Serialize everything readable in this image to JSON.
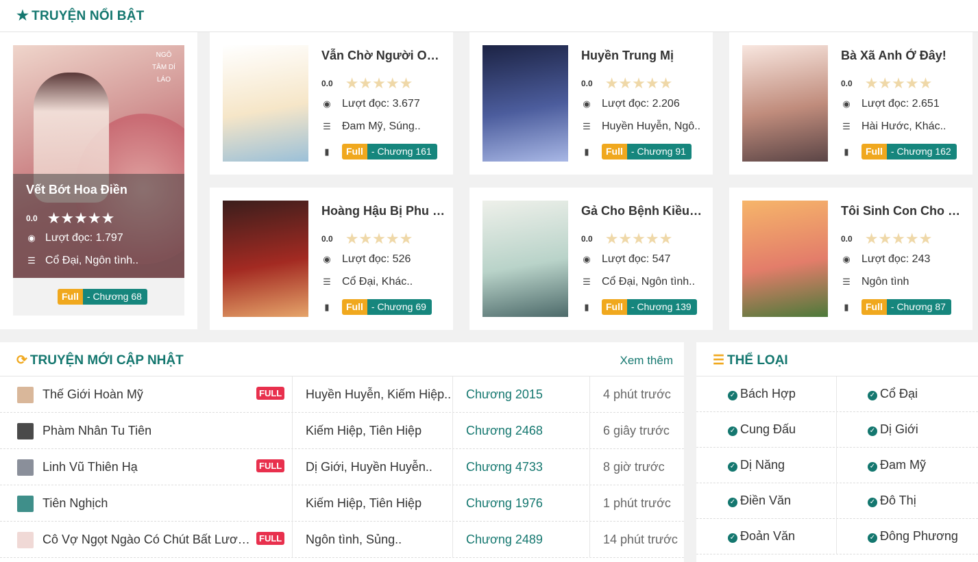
{
  "hot": {
    "title": "TRUYỆN NỔI BẬT",
    "featured": {
      "title": "Vết Bớt Hoa Điền",
      "rating": "0.0",
      "views": "Lượt đọc: 1.797",
      "genres": "Cổ Đại, Ngôn tình..",
      "full": "Full",
      "chapter": "- Chương 68",
      "cover_text": "Vết Bớt Hoa Điền",
      "cover_author": "NGÔ TÂM DÍ LÁO"
    },
    "cards": [
      {
        "title": "Vẫn Chờ Người Onlin...",
        "rating": "0.0",
        "views": "Lượt đọc: 3.677",
        "genres": "Đam Mỹ, Súng..",
        "full": "Full",
        "chapter": "- Chương 161",
        "colors": [
          "#ffffff",
          "#f6e6c8",
          "#9bc0d8"
        ]
      },
      {
        "title": "Huyền Trung Mị",
        "rating": "0.0",
        "views": "Lượt đọc: 2.206",
        "genres": "Huyền Huyễn, Ngô..",
        "full": "Full",
        "chapter": "- Chương 91",
        "colors": [
          "#1c2344",
          "#4c5d9d",
          "#a8b7e5"
        ]
      },
      {
        "title": "Bà Xã Anh Ở Đây!",
        "rating": "0.0",
        "views": "Lượt đọc: 2.651",
        "genres": "Hài Hước, Khác..",
        "full": "Full",
        "chapter": "- Chương 162",
        "colors": [
          "#f8e6df",
          "#c08c7c",
          "#5b4546"
        ]
      },
      {
        "title": "Hoàng Hậu Bị Phu Q...",
        "rating": "0.0",
        "views": "Lượt đọc: 526",
        "genres": "Cổ Đại, Khác..",
        "full": "Full",
        "chapter": "- Chương 69",
        "colors": [
          "#3b1e1c",
          "#a32a22",
          "#e5a46a"
        ]
      },
      {
        "title": "Gả Cho Bệnh Kiều, T...",
        "rating": "0.0",
        "views": "Lượt đọc: 547",
        "genres": "Cổ Đại, Ngôn tình..",
        "full": "Full",
        "chapter": "- Chương 139",
        "colors": [
          "#eef0ea",
          "#b9d3c9",
          "#4d6a6a"
        ]
      },
      {
        "title": "Tôi Sinh Con Cho Tổn...",
        "rating": "0.0",
        "views": "Lượt đọc: 243",
        "genres": "Ngôn tình",
        "full": "Full",
        "chapter": "- Chương 87",
        "colors": [
          "#f6b56a",
          "#e37d6a",
          "#4c7a3a"
        ]
      }
    ]
  },
  "updates": {
    "title": "TRUYỆN MỚI CẬP NHẬT",
    "more": "Xem thêm",
    "rows": [
      {
        "name": "Thế Giới Hoàn Mỹ",
        "full": "FULL",
        "genres": "Huyền Huyễn, Kiếm Hiệp..",
        "chapter": "Chương 2015",
        "time": "4 phút trước",
        "avatar": "#d9b79a"
      },
      {
        "name": "Phàm Nhân Tu Tiên",
        "full": "",
        "genres": "Kiếm Hiệp, Tiên Hiệp",
        "chapter": "Chương 2468",
        "time": "6 giây trước",
        "avatar": "#4a4a4a"
      },
      {
        "name": "Linh Vũ Thiên Hạ",
        "full": "FULL",
        "genres": "Dị Giới, Huyền Huyễn..",
        "chapter": "Chương 4733",
        "time": "8 giờ trước",
        "avatar": "#8a8f9a"
      },
      {
        "name": "Tiên Nghịch",
        "full": "",
        "genres": "Kiếm Hiệp, Tiên Hiệp",
        "chapter": "Chương 1976",
        "time": "1 phút trước",
        "avatar": "#3f8f8a"
      },
      {
        "name": "Cô Vợ Ngọt Ngào Có Chút Bất Lương (...",
        "full": "FULL",
        "genres": "Ngôn tình, Sủng..",
        "chapter": "Chương 2489",
        "time": "14 phút trước",
        "avatar": "#f0d9d6"
      }
    ]
  },
  "categories": {
    "title": "THỂ LOẠI",
    "items": [
      [
        "Bách Hợp",
        "Cổ Đại"
      ],
      [
        "Cung Đấu",
        "Dị Giới"
      ],
      [
        "Dị Năng",
        "Đam Mỹ"
      ],
      [
        "Điền Văn",
        "Đô Thị"
      ],
      [
        "Đoản Văn",
        "Đông Phương"
      ]
    ]
  },
  "theme": {
    "accent": "#14776f",
    "full_badge": "#f0a81e",
    "chapter_badge": "#16867d",
    "hot_full": "#e8304d"
  }
}
